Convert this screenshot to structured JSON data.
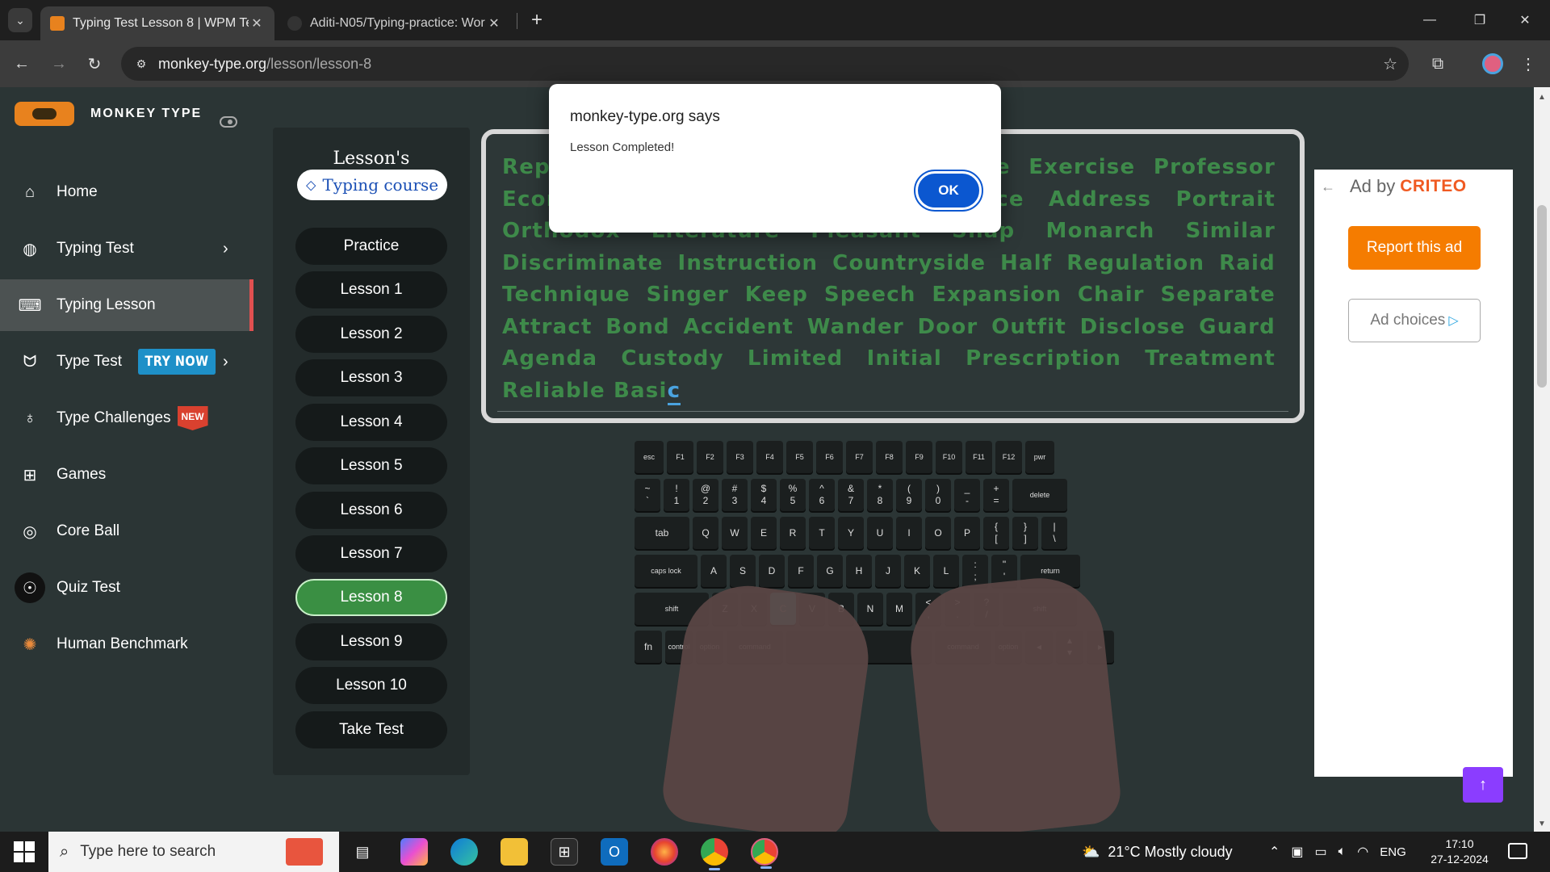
{
  "browser": {
    "tabs": [
      {
        "title": "Typing Test Lesson 8 | WPM Tes",
        "active": true
      },
      {
        "title": "Aditi-N05/Typing-practice: Wor",
        "active": false
      }
    ],
    "url": {
      "host": "monkey-type.org",
      "path": "/lesson/lesson-8"
    }
  },
  "sidebar": {
    "brand": "MONKEY TYPE",
    "items": [
      {
        "label": "Home"
      },
      {
        "label": "Typing Test"
      },
      {
        "label": "Typing Lesson"
      },
      {
        "label": "Type Test",
        "badge": "TRY NOW"
      },
      {
        "label": "Type Challenges",
        "badge": "NEW"
      },
      {
        "label": "Games"
      },
      {
        "label": "Core Ball"
      },
      {
        "label": "Quiz Test"
      },
      {
        "label": "Human Benchmark"
      }
    ]
  },
  "lessons": {
    "title": "Lesson's",
    "course_label": "Typing course",
    "buttons": [
      "Practice",
      "Lesson 1",
      "Lesson 2",
      "Lesson 3",
      "Lesson 4",
      "Lesson 5",
      "Lesson 6",
      "Lesson 7",
      "Lesson 8",
      "Lesson 9",
      "Lesson 10",
      "Take Test"
    ],
    "active": "Lesson 8"
  },
  "typing_text": {
    "visible": "Rep                                           rimination Headquarters Qua                                          ne Exercise Professor Economics Original Freighter Licence Address Portrait Orthodox Literature Pleasant Snap Monarch Similar Discriminate Instruction Countryside Half Regulation Raid Technique Singer Keep Speech Expansion Chair Separate Attract Bond Accident Wander Door Outfit Disclose Guard Agenda Custody Limited Initial Prescription Treatment Reliable Basi",
    "cursor_char": "c"
  },
  "keyboard": {
    "row0": [
      "esc",
      "F1",
      "F2",
      "F3",
      "F4",
      "F5",
      "F6",
      "F7",
      "F8",
      "F9",
      "F10",
      "F11",
      "F12",
      "pwr"
    ],
    "row1": [
      "~\n`",
      "!\n1",
      "@\n2",
      "#\n3",
      "$\n4",
      "%\n5",
      "^\n6",
      "&\n7",
      "*\n8",
      "(\n9",
      ")\n0",
      "_\n-",
      "+\n=",
      "delete"
    ],
    "row2": [
      "tab",
      "Q",
      "W",
      "E",
      "R",
      "T",
      "Y",
      "U",
      "I",
      "O",
      "P",
      "{\n[",
      "}\n]",
      "|\n\\"
    ],
    "row3": [
      "caps lock",
      "A",
      "S",
      "D",
      "F",
      "G",
      "H",
      "J",
      "K",
      "L",
      ":\n;",
      "\"\n'",
      "return"
    ],
    "row4": [
      "shift",
      "Z",
      "X",
      "C",
      "V",
      "B",
      "N",
      "M",
      "<\n,",
      ">\n.",
      "?\n/",
      "shift"
    ],
    "row5": [
      "fn",
      "control",
      "option",
      "command",
      "",
      "command",
      "option",
      "◂",
      "▴\n▾",
      "▸"
    ],
    "highlighted": "C"
  },
  "ad": {
    "label": "Ad by",
    "brand": "CRITEO",
    "report": "Report this ad",
    "choices": "Ad choices",
    "accent": "#f57c00"
  },
  "dialog": {
    "title": "monkey-type.org says",
    "message": "Lesson Completed!",
    "ok": "OK"
  },
  "taskbar": {
    "search_placeholder": "Type here to search",
    "weather": "21°C  Mostly cloudy",
    "lang": "ENG",
    "time": "17:10",
    "date": "27-12-2024"
  }
}
